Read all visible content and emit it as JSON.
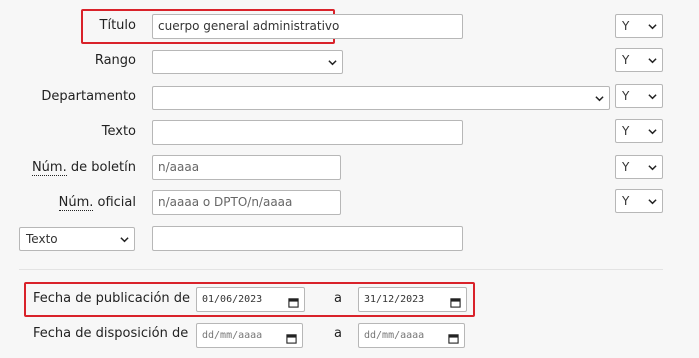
{
  "colors": {
    "highlight": "#d9222a",
    "background": "#f7f7f7",
    "border": "#b7b7b7"
  },
  "rows": {
    "titulo": {
      "label": "Título",
      "value": "cuerpo general administrativo",
      "operator": "Y"
    },
    "rango": {
      "label": "Rango",
      "value": "",
      "operator": "Y"
    },
    "departamento": {
      "label": "Departamento",
      "value": "",
      "operator": "Y"
    },
    "texto": {
      "label": "Texto",
      "value": "",
      "operator": "Y"
    },
    "boletin": {
      "label_abbr": "Núm.",
      "label_rest": " de boletín",
      "placeholder": "n/aaaa",
      "operator": "Y"
    },
    "oficial": {
      "label_abbr": "Núm.",
      "label_rest": " oficial",
      "placeholder": "n/aaaa o DPTO/n/aaaa",
      "operator": "Y"
    },
    "extra": {
      "field_select": "Texto",
      "value": ""
    }
  },
  "dates": {
    "publicacion": {
      "label": "Fecha de publicación de",
      "from": "01/06/2023",
      "to_label": "a",
      "to": "31/12/2023"
    },
    "disposicion": {
      "label": "Fecha de disposición de",
      "from_placeholder": "dd/mm/aaaa",
      "to_label": "a",
      "to_placeholder": "dd/mm/aaaa"
    }
  }
}
